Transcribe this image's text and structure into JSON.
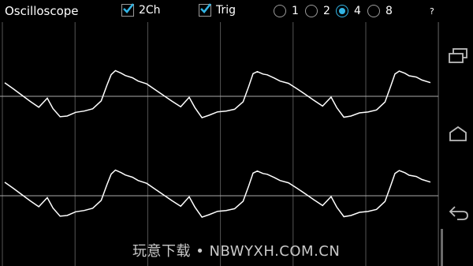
{
  "app": {
    "title": "Oscilloscope"
  },
  "options": {
    "two_channel": {
      "label": "2Ch",
      "checked": true
    },
    "trigger": {
      "label": "Trig",
      "checked": true
    }
  },
  "timebase": {
    "options": [
      "1",
      "2",
      "4",
      "8"
    ],
    "selected": "4"
  },
  "help_label": "?",
  "watermark": "玩意下载 • NBWYXH.COM.CN",
  "nav": {
    "icons": [
      "recent-apps-icon",
      "home-icon",
      "back-icon"
    ]
  },
  "colors": {
    "background": "#000000",
    "grid": "#555555",
    "trace": "#ffffff",
    "accent": "#33b5e5"
  },
  "scope": {
    "channels": 2,
    "trace_periods": 3,
    "trigger_level_lines": 2,
    "grid": true
  }
}
